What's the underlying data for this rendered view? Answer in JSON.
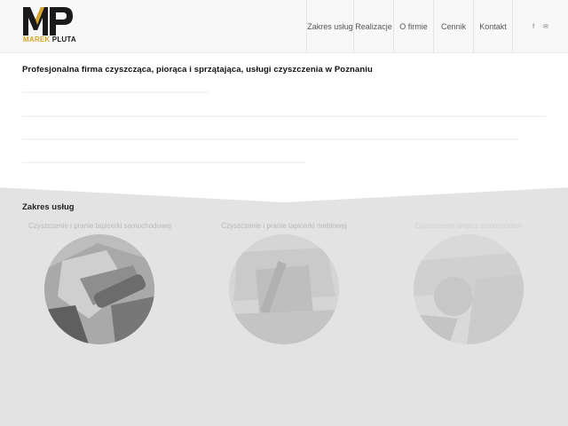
{
  "logo": {
    "initials": "MP",
    "first": "MAREK",
    "last": "PLUTA"
  },
  "nav": {
    "items": [
      {
        "label": "Zakres usług"
      },
      {
        "label": "Realizacje"
      },
      {
        "label": "O firmie"
      },
      {
        "label": "Cennik"
      },
      {
        "label": "Kontakt"
      }
    ],
    "social": {
      "facebook": "f",
      "email": "✉"
    }
  },
  "intro": {
    "heading": "Profesjonalna firma czyszcząca, piorąca i sprzątająca, usługi czyszczenia w Poznaniu"
  },
  "services": {
    "title": "Zakres usług",
    "items": [
      {
        "label": "Czyszczenie i pranie tapicerki samochodowej"
      },
      {
        "label": "Czyszczenie i pranie tapicerki meblowej"
      },
      {
        "label": "Czyszczenie wnętrz samochodów"
      }
    ]
  }
}
